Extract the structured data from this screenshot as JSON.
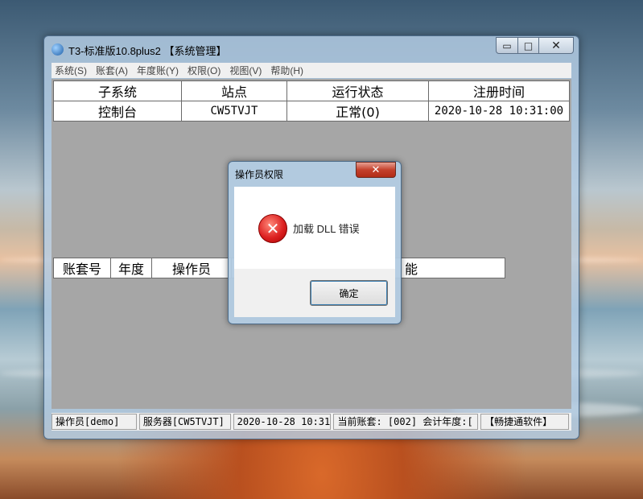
{
  "window": {
    "title": "T3-标准版10.8plus2 【系统管理】",
    "min_glyph": "▭",
    "max_glyph": "□",
    "close_glyph": "✕"
  },
  "menu": [
    {
      "label": "系统(S)"
    },
    {
      "label": "账套(A)"
    },
    {
      "label": "年度账(Y)"
    },
    {
      "label": "权限(O)"
    },
    {
      "label": "视图(V)"
    },
    {
      "label": "帮助(H)"
    }
  ],
  "subsystem_table": {
    "headers": [
      "子系统",
      "站点",
      "运行状态",
      "注册时间"
    ],
    "rows": [
      [
        "控制台",
        "CW5TVJT",
        "正常(0)",
        "2020-10-28 10:31:00"
      ]
    ]
  },
  "task_table": {
    "headers": [
      "账套号",
      "年度",
      "操作员",
      "",
      "能"
    ]
  },
  "status_bar": [
    "操作员[demo]",
    "服务器[CW5TVJT]",
    "2020-10-28 10:31",
    "当前账套: [002] 会计年度:[",
    "【畅捷通软件】"
  ],
  "dialog": {
    "title": "操作员权限",
    "close_glyph": "✕",
    "icon": "error-icon",
    "icon_glyph": "✕",
    "message": "加载 DLL 错误",
    "ok_label": "确定"
  }
}
